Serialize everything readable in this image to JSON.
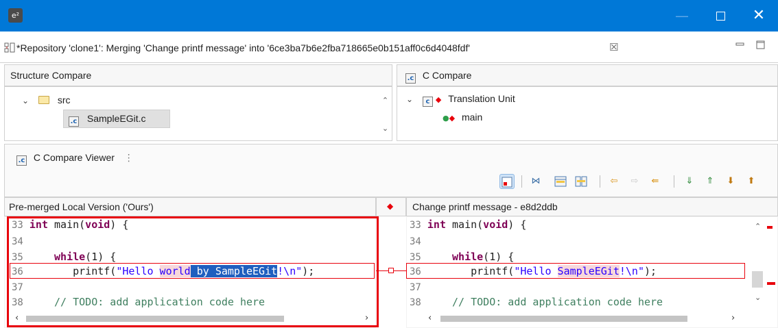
{
  "window": {
    "app_icon": "e²",
    "minimize": "—",
    "close": "✕"
  },
  "editor_tab": {
    "icon": "merge-editor-icon",
    "title": "*Repository 'clone1': Merging 'Change printf message' into '6ce3ba7b6e2fba718665e0b151aff0c6d4048fdf'",
    "close": "☒",
    "minimize": "▭",
    "maximize": "▢"
  },
  "structure_compare": {
    "header": "Structure Compare",
    "items": [
      {
        "label": "src",
        "icon": "folder-icon"
      },
      {
        "label": "SampleEGit.c",
        "icon": "c-file-icon"
      }
    ]
  },
  "c_compare": {
    "header": "C Compare",
    "items": [
      {
        "label": "Translation Unit",
        "icon": "translation-unit-icon"
      },
      {
        "label": "main",
        "icon": "function-conflict-icon"
      }
    ]
  },
  "viewer": {
    "title": "C Compare Viewer",
    "menu_icon": "⋮"
  },
  "toolbar": {
    "icons": [
      "show-ancestor-icon",
      "ignore-whitespace-icon",
      "copy-all-left-icon",
      "copy-all-right-icon",
      "copy-left-icon",
      "copy-right-icon",
      "copy-right-2-icon",
      "next-difference-icon",
      "previous-difference-icon",
      "next-change-icon",
      "previous-change-icon"
    ]
  },
  "left_pane": {
    "header": "Pre-merged Local Version ('Ours')",
    "lines": [
      {
        "num": "33",
        "code": "int main(void) {"
      },
      {
        "num": "34",
        "code": ""
      },
      {
        "num": "35",
        "code": "    while(1) {"
      },
      {
        "num": "36",
        "code": "        printf(\"Hello world by SampleEGit!\\n\");"
      },
      {
        "num": "37",
        "code": ""
      },
      {
        "num": "38",
        "code": "    // TODO: add application code here"
      }
    ],
    "l36": {
      "indent": "        ",
      "fn": "printf(",
      "s1": "\"Hello ",
      "diff": "world",
      "sel": " by SampleEGit",
      "s2": "!\\n\"",
      "tail": ");"
    }
  },
  "right_pane": {
    "header": "Change printf message - e8d2ddb",
    "lines": [
      {
        "num": "33",
        "code": "int main(void) {"
      },
      {
        "num": "34",
        "code": ""
      },
      {
        "num": "35",
        "code": "    while(1) {"
      },
      {
        "num": "36",
        "code": "        printf(\"Hello SampleEGit!\\n\");"
      },
      {
        "num": "37",
        "code": ""
      },
      {
        "num": "38",
        "code": "    // TODO: add application code here"
      }
    ],
    "l36": {
      "indent": "        ",
      "fn": "printf(",
      "s1": "\"Hello ",
      "diff": "SampleEGit",
      "s2": "!\\n\"",
      "tail": ");"
    }
  },
  "colors": {
    "titlebar": "#0078d7",
    "conflict_red": "#e8000b",
    "diff_highlight": "#f7d7db",
    "selection": "#1f5fbf"
  }
}
